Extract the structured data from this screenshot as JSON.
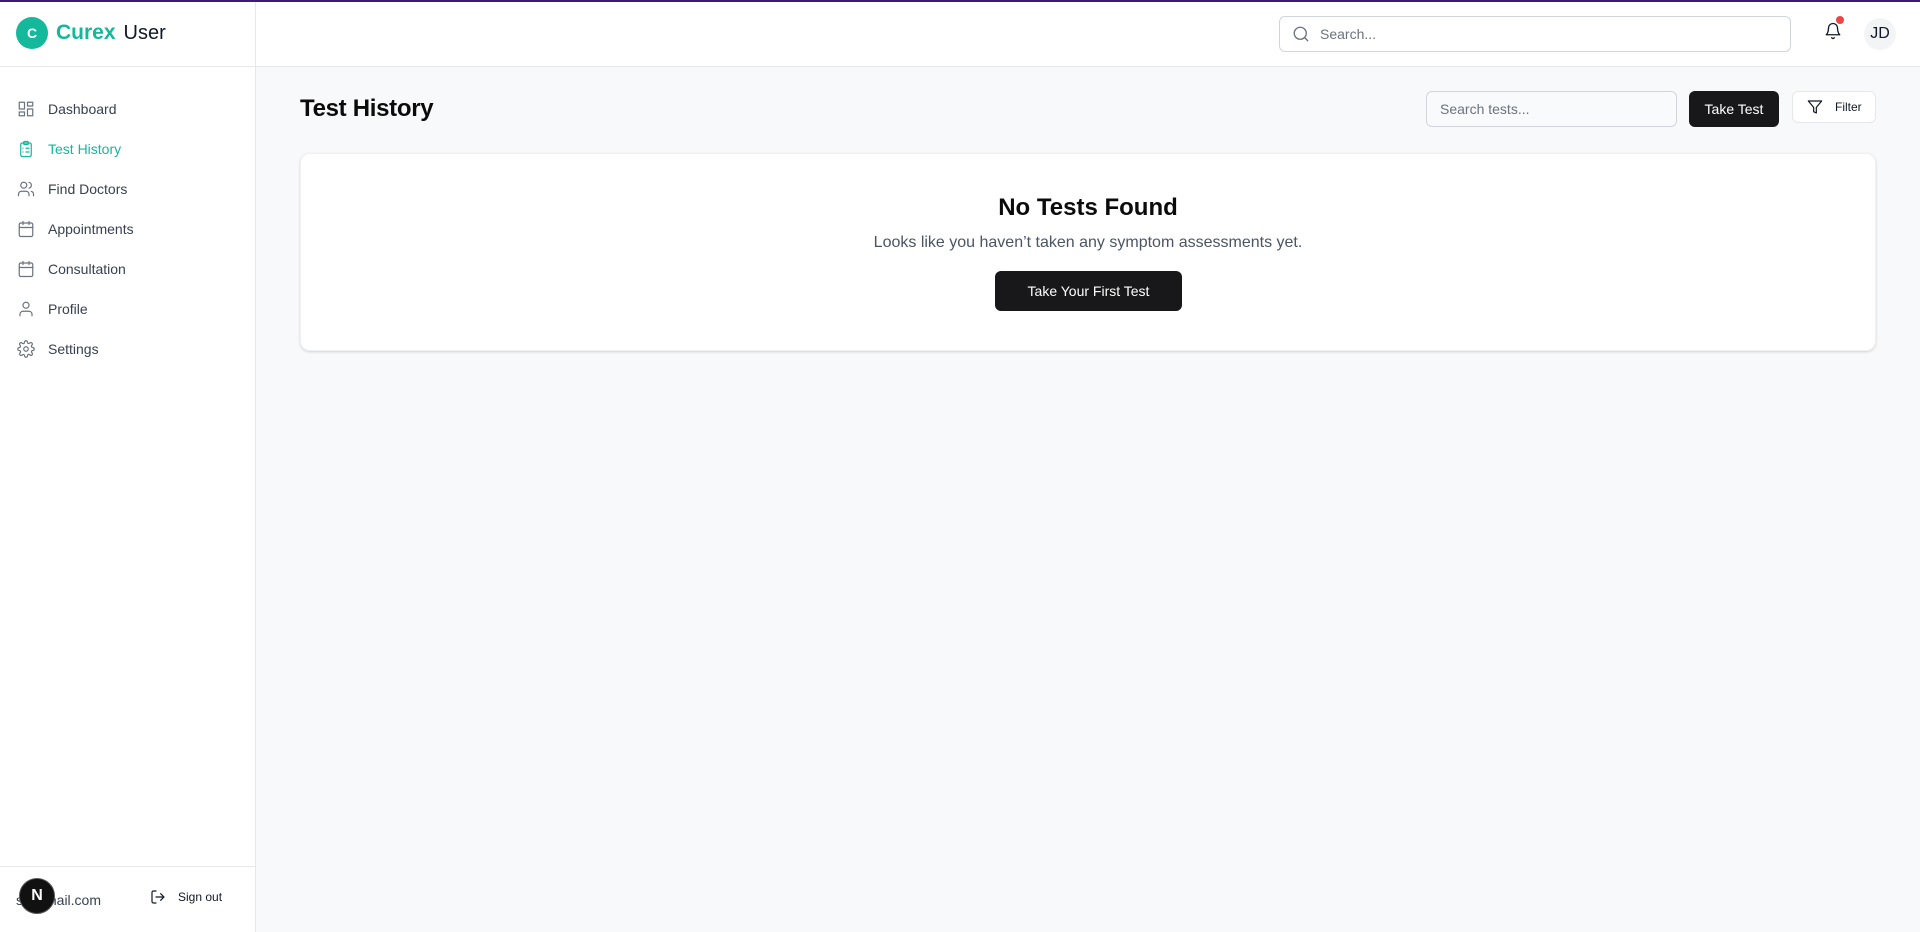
{
  "app": {
    "logo_letter": "C",
    "brand_name": "Curex",
    "role": "User"
  },
  "sidebar": {
    "items": [
      {
        "label": "Dashboard",
        "icon": "dashboard-grid-icon",
        "active": false
      },
      {
        "label": "Test History",
        "icon": "clipboard-list-icon",
        "active": true
      },
      {
        "label": "Find Doctors",
        "icon": "users-icon",
        "active": false
      },
      {
        "label": "Appointments",
        "icon": "calendar-icon",
        "active": false
      },
      {
        "label": "Consultation",
        "icon": "calendar-icon",
        "active": false
      },
      {
        "label": "Profile",
        "icon": "user-icon",
        "active": false
      },
      {
        "label": "Settings",
        "icon": "gear-icon",
        "active": false
      }
    ],
    "footer": {
      "email": "s@gmail.com",
      "sign_out_label": "Sign out",
      "dev_badge_letter": "N"
    }
  },
  "header": {
    "search_placeholder": "Search...",
    "avatar_initials": "JD",
    "notification_dot": true
  },
  "main": {
    "title": "Test History",
    "search_placeholder": "Search tests...",
    "take_test_label": "Take Test",
    "filter_label": "Filter",
    "empty_state": {
      "title": "No Tests Found",
      "message": "Looks like you haven’t taken any symptom assessments yet.",
      "button_label": "Take Your First Test"
    }
  },
  "colors": {
    "accent": "#14b89a",
    "dark_button": "#18181b",
    "notification": "#ef4444"
  }
}
